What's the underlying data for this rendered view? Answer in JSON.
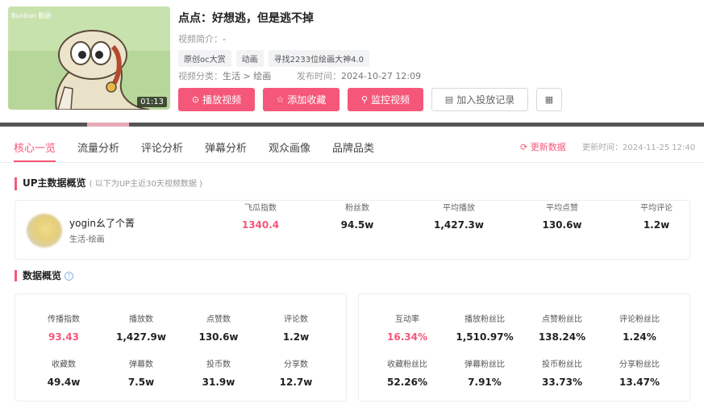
{
  "video": {
    "duration": "01:13",
    "thumb_text": "Bunbun 動画",
    "title": "点点：好想逃，但是逃不掉",
    "intro_label": "视频简介：",
    "intro_value": "-",
    "tags": [
      "原创oc大赏",
      "动画",
      "寻找2233位绘画大神4.0"
    ],
    "category_label": "视频分类：",
    "category_value": "生活 > 绘画",
    "publish_label": "发布时间：",
    "publish_value": "2024-10-27 12:09",
    "buttons": {
      "play": "播放视频",
      "favorite": "添加收藏",
      "monitor": "监控视频",
      "ad_record": "加入投放记录"
    }
  },
  "tabs": [
    "核心一览",
    "流量分析",
    "评论分析",
    "弹幕分析",
    "观众画像",
    "品牌品类"
  ],
  "refresh_label": "更新数据",
  "update_time": "更新时间：2024-11-25 12:40",
  "up_section": {
    "title": "UP主数据概览",
    "subtitle": "( 以下为UP主近30天视频数据 )",
    "name": "yogin幺了个菁",
    "category": "生活-绘画",
    "stats": [
      {
        "label": "飞瓜指数",
        "value": "1340.4",
        "pink": true
      },
      {
        "label": "粉丝数",
        "value": "94.5w",
        "pink": false
      },
      {
        "label": "平均播放",
        "value": "1,427.3w",
        "pink": false
      },
      {
        "label": "平均点赞",
        "value": "130.6w",
        "pink": false
      },
      {
        "label": "平均评论",
        "value": "1.2w",
        "pink": false
      }
    ]
  },
  "data_section": {
    "title": "数据概览",
    "left": [
      {
        "label": "传播指数",
        "value": "93.43",
        "pink": true
      },
      {
        "label": "播放数",
        "value": "1,427.9w",
        "pink": false
      },
      {
        "label": "点赞数",
        "value": "130.6w",
        "pink": false
      },
      {
        "label": "评论数",
        "value": "1.2w",
        "pink": false
      },
      {
        "label": "收藏数",
        "value": "49.4w",
        "pink": false
      },
      {
        "label": "弹幕数",
        "value": "7.5w",
        "pink": false
      },
      {
        "label": "投币数",
        "value": "31.9w",
        "pink": false
      },
      {
        "label": "分享数",
        "value": "12.7w",
        "pink": false
      }
    ],
    "right": [
      {
        "label": "互动率",
        "value": "16.34%",
        "pink": true
      },
      {
        "label": "播放粉丝比",
        "value": "1,510.97%",
        "pink": false
      },
      {
        "label": "点赞粉丝比",
        "value": "138.24%",
        "pink": false
      },
      {
        "label": "评论粉丝比",
        "value": "1.24%",
        "pink": false
      },
      {
        "label": "收藏粉丝比",
        "value": "52.26%",
        "pink": false
      },
      {
        "label": "弹幕粉丝比",
        "value": "7.91%",
        "pink": false
      },
      {
        "label": "投币粉丝比",
        "value": "33.73%",
        "pink": false
      },
      {
        "label": "分享粉丝比",
        "value": "13.47%",
        "pink": false
      }
    ]
  },
  "colors": {
    "accent": "#f5577a",
    "text": "#222222",
    "muted": "#999999"
  }
}
